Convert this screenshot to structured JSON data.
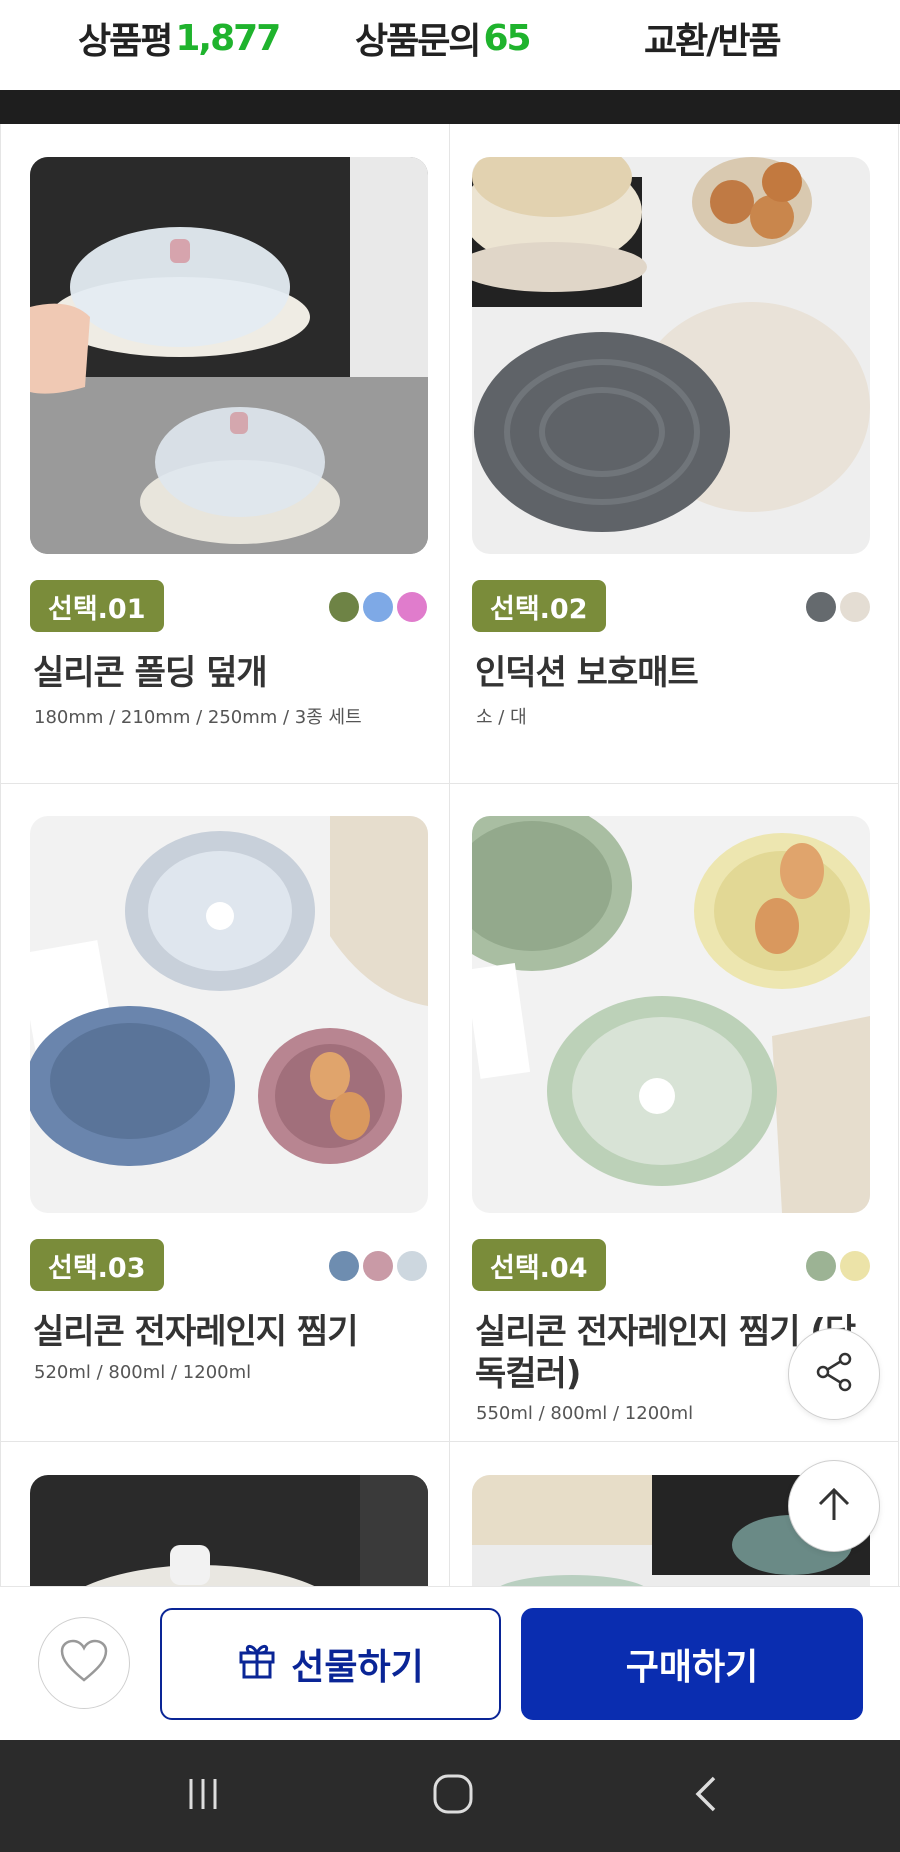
{
  "tabs": {
    "reviews_label": "상품평",
    "reviews_count": "1,877",
    "qna_label": "상품문의",
    "qna_count": "65",
    "exchange_label": "교환/반품"
  },
  "colors": {
    "accent_green": "#1fb32d",
    "badge_olive": "#7a8c3a",
    "brand_blue": "#0a2db0"
  },
  "products": [
    {
      "badge": "선택.01",
      "title": "실리콘 폴딩 덮개",
      "subtitle": "180mm / 210mm / 250mm / 3종 세트",
      "swatches": [
        "#6e8345",
        "#7ea9e6",
        "#e07ccc"
      ]
    },
    {
      "badge": "선택.02",
      "title": "인덕션 보호매트",
      "subtitle": "소 / 대",
      "swatches": [
        "#656a6e",
        "#e4ddd3"
      ]
    },
    {
      "badge": "선택.03",
      "title": "실리콘 전자레인지 찜기",
      "subtitle": "520ml / 800ml / 1200ml",
      "swatches": [
        "#6e8db0",
        "#c99aa6",
        "#cdd7df"
      ]
    },
    {
      "badge": "선택.04",
      "title": "실리콘 전자레인지 찜기 (단독컬러)",
      "subtitle": "550ml / 800ml / 1200ml",
      "swatches": [
        "#9cb394",
        "#ece3a8"
      ]
    }
  ],
  "actions": {
    "gift_label": "선물하기",
    "buy_label": "구매하기"
  },
  "icons": {
    "wishlist": "heart-icon",
    "gift": "gift-icon",
    "share": "share-icon",
    "scroll_top": "arrow-up-icon",
    "nav_recent": "recent-apps-icon",
    "nav_home": "home-icon",
    "nav_back": "back-icon"
  }
}
